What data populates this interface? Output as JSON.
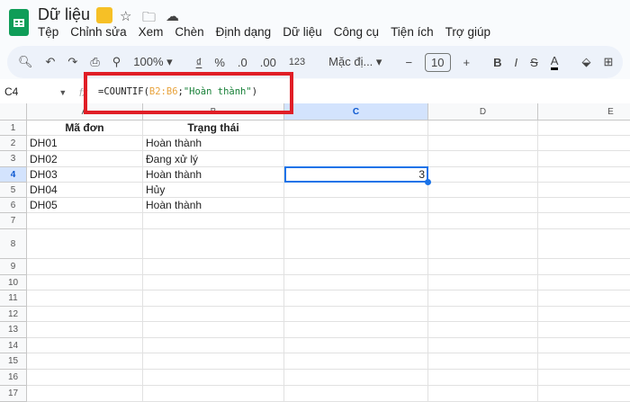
{
  "doc": {
    "title": "Dữ liệu"
  },
  "menu": [
    "Tệp",
    "Chỉnh sửa",
    "Xem",
    "Chèn",
    "Định dạng",
    "Dữ liệu",
    "Công cụ",
    "Tiện ích",
    "Trợ giúp"
  ],
  "toolbar": {
    "zoom": "100%",
    "currency": "₫",
    "percent": "%",
    "dec_less": ".0",
    "dec_more": ".00",
    "number_format": "123",
    "font": "Mặc đị...",
    "font_size": "10",
    "minus": "−",
    "plus": "+",
    "bold": "B",
    "italic": "I",
    "strike": "S",
    "text_color": "A"
  },
  "formula_bar": {
    "name_box": "C4",
    "fx": "fx",
    "formula_prefix": "=COUNTIF(",
    "formula_range": "B2:B6",
    "formula_sep": ";",
    "formula_string": "\"Hoàn thành\"",
    "formula_suffix": ")"
  },
  "grid": {
    "columns": [
      "A",
      "B",
      "C",
      "D",
      "E"
    ],
    "rows": [
      "1",
      "2",
      "3",
      "4",
      "5",
      "6",
      "7",
      "8",
      "9",
      "10",
      "11",
      "12",
      "13",
      "14",
      "15",
      "16",
      "17"
    ],
    "cells": [
      [
        "Mã đơn",
        "Trạng thái"
      ],
      [
        "DH01",
        "Hoàn thành"
      ],
      [
        "DH02",
        "Đang xử lý"
      ],
      [
        "DH03",
        "Hoàn thành"
      ],
      [
        "DH04",
        "Hủy"
      ],
      [
        "DH05",
        "Hoàn thành"
      ]
    ],
    "selected_cell": "C4",
    "c4_value": "3"
  }
}
